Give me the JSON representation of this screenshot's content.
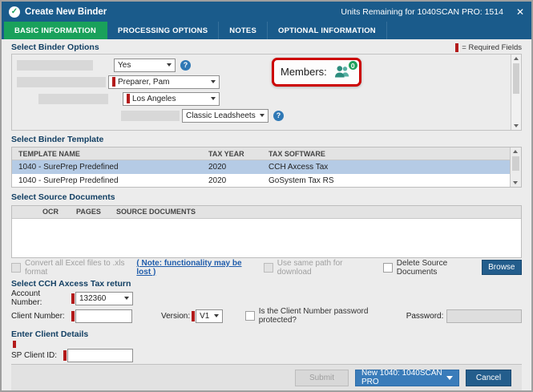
{
  "titlebar": {
    "app_icon_glyph": "✓",
    "title": "Create New Binder",
    "units_remaining": "Units Remaining for 1040SCAN PRO: 1514",
    "close_glyph": "✕"
  },
  "tabs": [
    {
      "label": "BASIC INFORMATION",
      "active": true
    },
    {
      "label": "PROCESSING OPTIONS",
      "active": false
    },
    {
      "label": "NOTES",
      "active": false
    },
    {
      "label": "OPTIONAL INFORMATION",
      "active": false
    }
  ],
  "binder_options": {
    "title": "Select Binder Options",
    "required_legend": "= Required Fields",
    "help_glyph": "?",
    "field1_value": "Yes",
    "preparer_value": "Preparer, Pam",
    "office_value": "Los Angeles",
    "leadsheet_value": "Classic Leadsheets",
    "members_label": "Members:",
    "members_count": "0"
  },
  "binder_template": {
    "title": "Select Binder Template",
    "columns": {
      "name": "TEMPLATE NAME",
      "year": "TAX YEAR",
      "software": "TAX SOFTWARE"
    },
    "rows": [
      {
        "name": "1040 - SurePrep Predefined",
        "year": "2020",
        "software": "CCH Axcess Tax",
        "selected": true
      },
      {
        "name": "1040 - SurePrep Predefined",
        "year": "2020",
        "software": "GoSystem Tax RS",
        "selected": false
      }
    ]
  },
  "source_documents": {
    "title": "Select Source Documents",
    "columns": {
      "ocr": "OCR",
      "pages": "PAGES",
      "documents": "SOURCE DOCUMENTS"
    },
    "convert_excel_label": "Convert all Excel files to .xls format",
    "note_link": "( Note: functionality may be lost )",
    "same_path_label": "Use same path for download",
    "delete_label": "Delete Source Documents",
    "browse_label": "Browse"
  },
  "tax_return": {
    "title": "Select CCH Axcess Tax return",
    "account_number_label": "Account Number:",
    "account_number_value": "132360",
    "client_number_label": "Client Number:",
    "client_number_value": "",
    "version_label": "Version:",
    "version_value": "V1",
    "password_protected_label": "Is the Client Number password protected?",
    "password_label": "Password:",
    "password_value": ""
  },
  "client_details": {
    "title": "Enter Client Details",
    "sp_client_id_label": "SP Client ID:",
    "sp_client_id_value": ""
  },
  "footer": {
    "submit_label": "Submit",
    "binder_type_value": "New 1040: 1040SCAN PRO",
    "cancel_label": "Cancel"
  },
  "colors": {
    "titlebar_blue": "#1a5b8b",
    "active_tab_green": "#19a15b",
    "required_red": "#b31b1b",
    "selected_row_blue": "#b5cbe5",
    "dark_button_blue": "#235d8c",
    "binder_dropdown_blue": "#3a7cba",
    "annotation_red": "#cc0000",
    "members_icon_teal": "#2c8c7d",
    "badge_green": "#1fa15c"
  }
}
